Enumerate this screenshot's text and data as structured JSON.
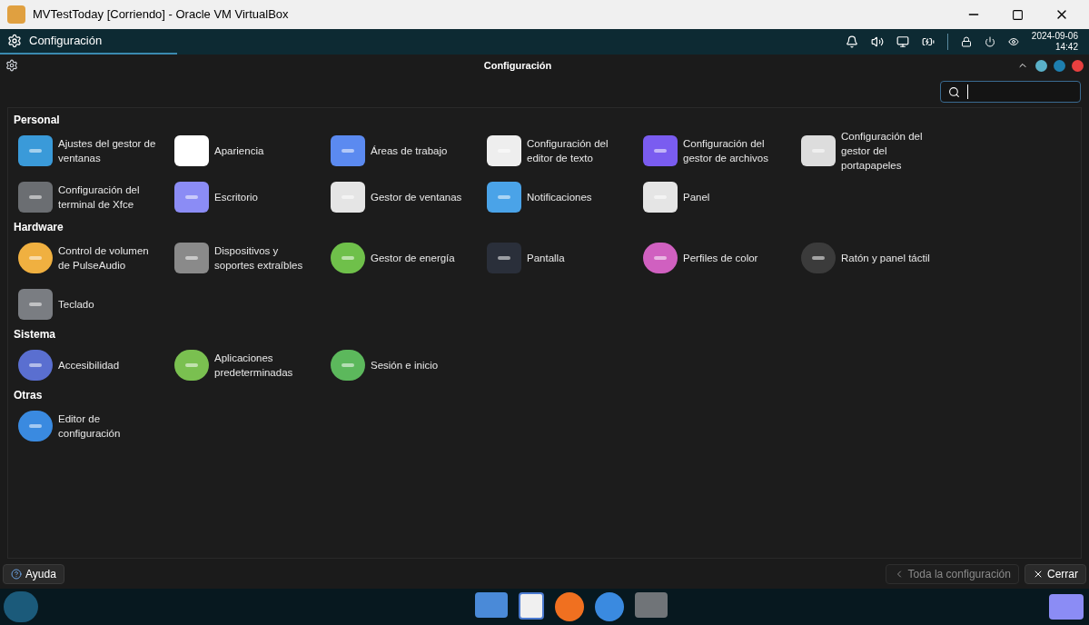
{
  "host_window": {
    "title": "MVTestToday [Corriendo] - Oracle VM VirtualBox"
  },
  "top_panel": {
    "app_button": "Configuración",
    "clock": {
      "date": "2024-09-06",
      "time": "14:42"
    }
  },
  "app_window": {
    "title": "Configuración"
  },
  "sections": [
    {
      "title": "Personal",
      "items": [
        {
          "label": "Ajustes del gestor de ventanas"
        },
        {
          "label": "Apariencia"
        },
        {
          "label": "Áreas de trabajo"
        },
        {
          "label": "Configuración del editor de texto"
        },
        {
          "label": "Configuración del gestor de archivos"
        },
        {
          "label": "Configuración del gestor del portapapeles"
        },
        {
          "label": "Configuración del terminal de Xfce"
        },
        {
          "label": "Escritorio"
        },
        {
          "label": "Gestor de ventanas"
        },
        {
          "label": "Notificaciones"
        },
        {
          "label": "Panel"
        }
      ]
    },
    {
      "title": "Hardware",
      "items": [
        {
          "label": "Control de volumen de PulseAudio"
        },
        {
          "label": "Dispositivos y soportes extraíbles"
        },
        {
          "label": "Gestor de energía"
        },
        {
          "label": "Pantalla"
        },
        {
          "label": "Perfiles de color"
        },
        {
          "label": "Ratón y panel táctil"
        },
        {
          "label": "Teclado"
        }
      ]
    },
    {
      "title": "Sistema",
      "items": [
        {
          "label": "Accesibilidad"
        },
        {
          "label": "Aplicaciones predeterminadas"
        },
        {
          "label": "Sesión e inicio"
        }
      ]
    },
    {
      "title": "Otras",
      "items": [
        {
          "label": "Editor de configuración"
        }
      ]
    }
  ],
  "buttons": {
    "help": "Ayuda",
    "all_settings": {
      "label": "Toda la configuración",
      "disabled": true
    },
    "close": "Cerrar"
  }
}
